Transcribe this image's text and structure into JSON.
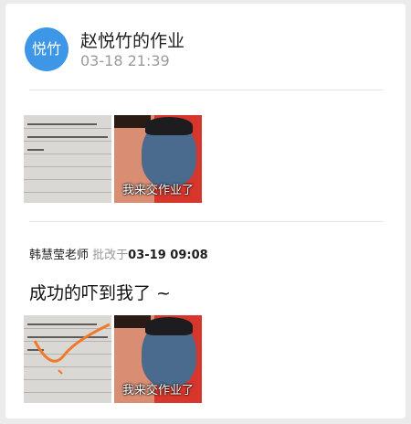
{
  "header": {
    "avatar_text": "悦竹",
    "title": "赵悦竹的作业",
    "timestamp": "03-18 21:39"
  },
  "submission": {
    "images": [
      {
        "kind": "notebook-photo"
      },
      {
        "kind": "meme",
        "caption": "我来交作业了"
      }
    ]
  },
  "review": {
    "teacher_name": "韩慧莹老师",
    "label": "批改于",
    "timestamp": "03-19 09:08",
    "comment": "成功的吓到我了 ~",
    "images": [
      {
        "kind": "notebook-photo-marked"
      },
      {
        "kind": "meme",
        "caption": "我来交作业了"
      }
    ]
  },
  "colors": {
    "avatar": "#3d97e6",
    "meme_bg": "#d6362b",
    "mark": "#f07a2a"
  }
}
